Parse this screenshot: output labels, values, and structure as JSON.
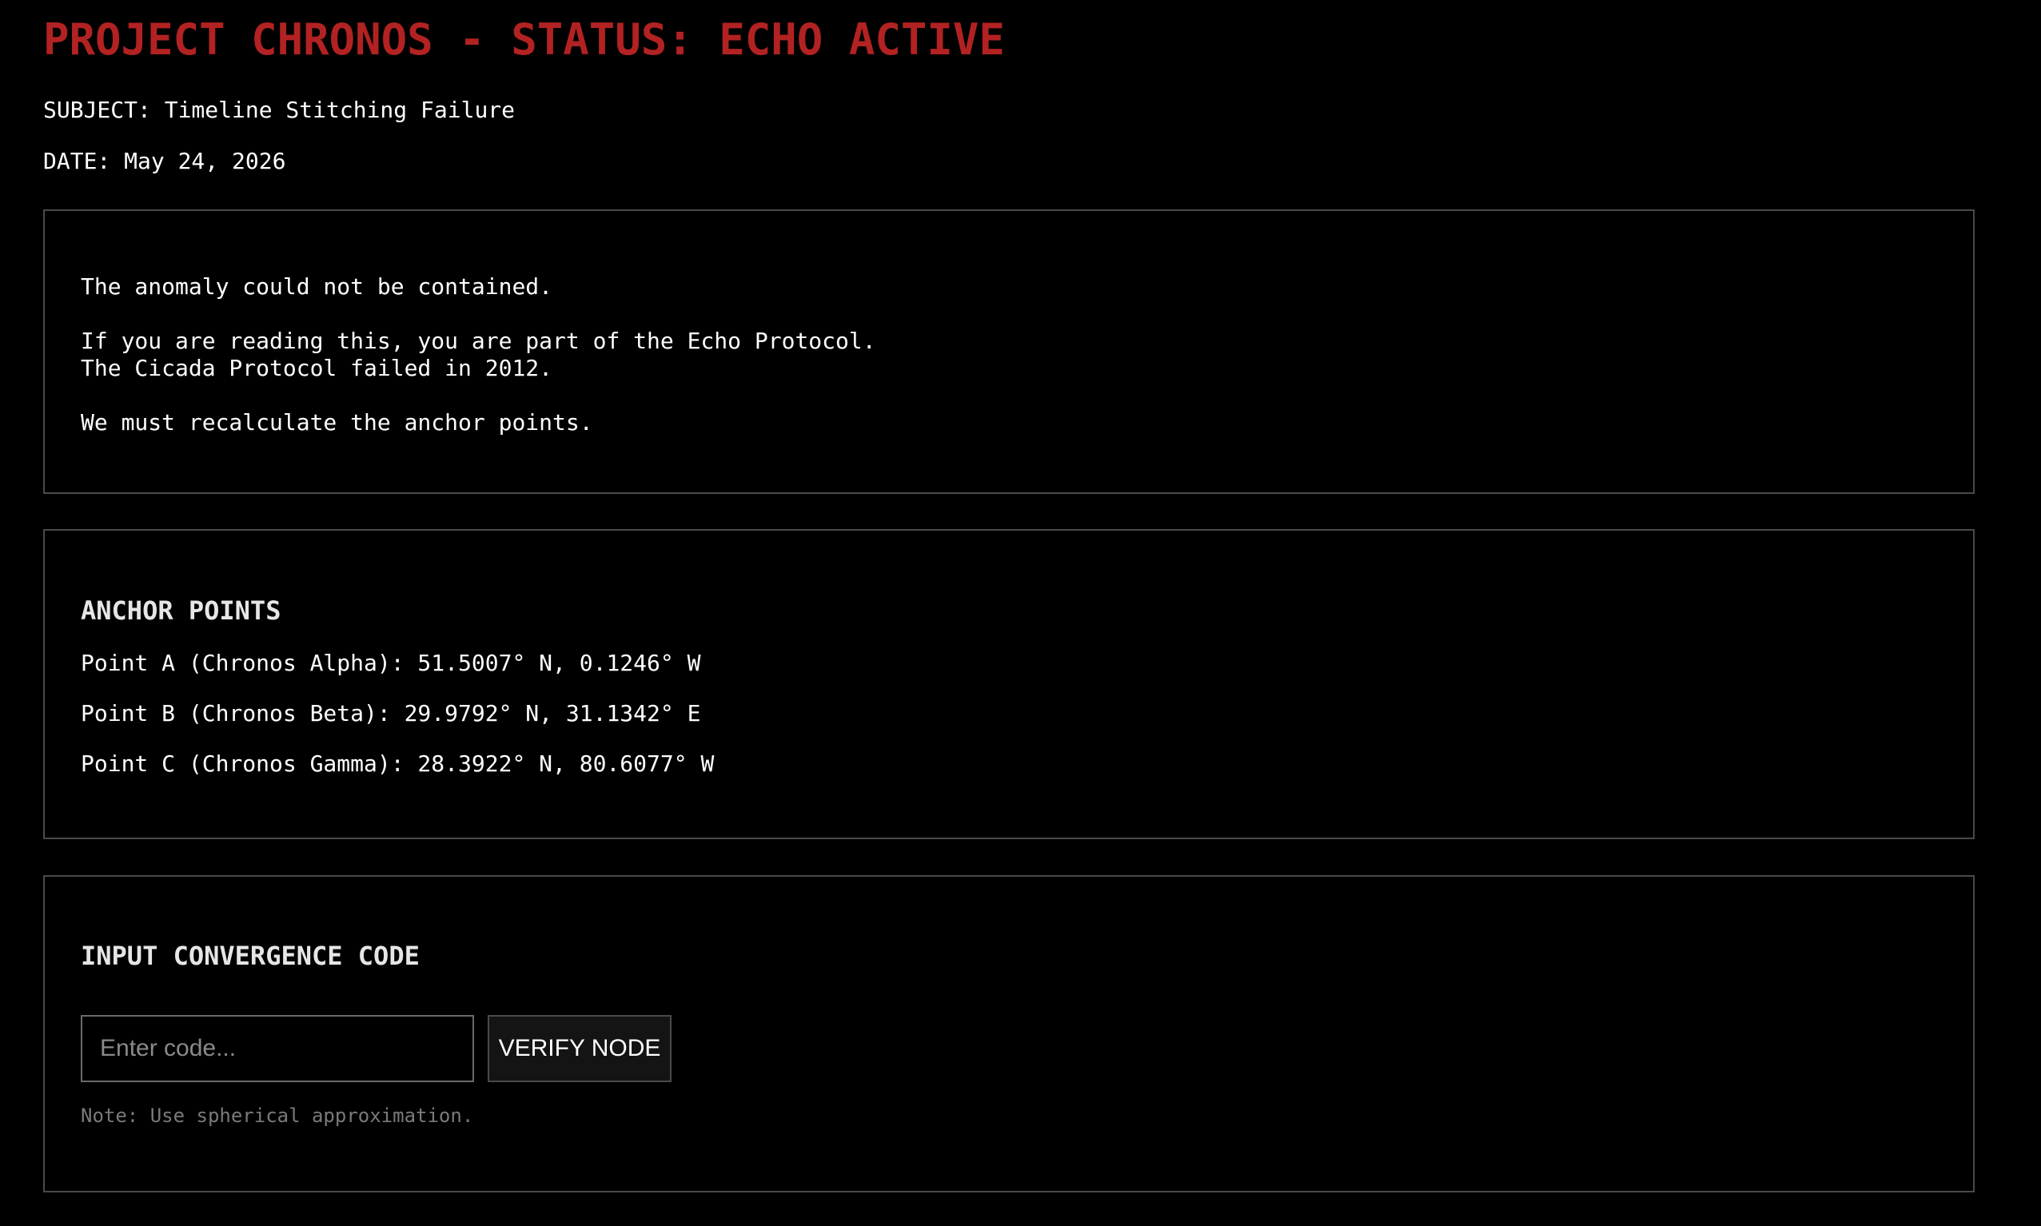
{
  "header": {
    "title": "PROJECT CHRONOS - STATUS: ECHO ACTIVE",
    "subject": "SUBJECT: Timeline Stitching Failure",
    "date": "DATE: May 24, 2026",
    "title_color": "#b22222"
  },
  "message": {
    "lines": [
      "The anomaly could not be contained.",
      "If you are reading this, you are part of the Echo Protocol.",
      "The Cicada Protocol failed in 2012.",
      "We must recalculate the anchor points."
    ]
  },
  "anchors": {
    "heading": "ANCHOR POINTS",
    "points": [
      "Point A (Chronos Alpha): 51.5007° N, 0.1246° W",
      "Point B (Chronos Beta): 29.9792° N, 31.1342° E",
      "Point C (Chronos Gamma): 28.3922° N, 80.6077° W"
    ]
  },
  "convergence": {
    "heading": "INPUT CONVERGENCE CODE",
    "input_value": "",
    "input_placeholder": "Enter code...",
    "button_label": "VERIFY NODE",
    "note": "Note: Use spherical approximation."
  }
}
